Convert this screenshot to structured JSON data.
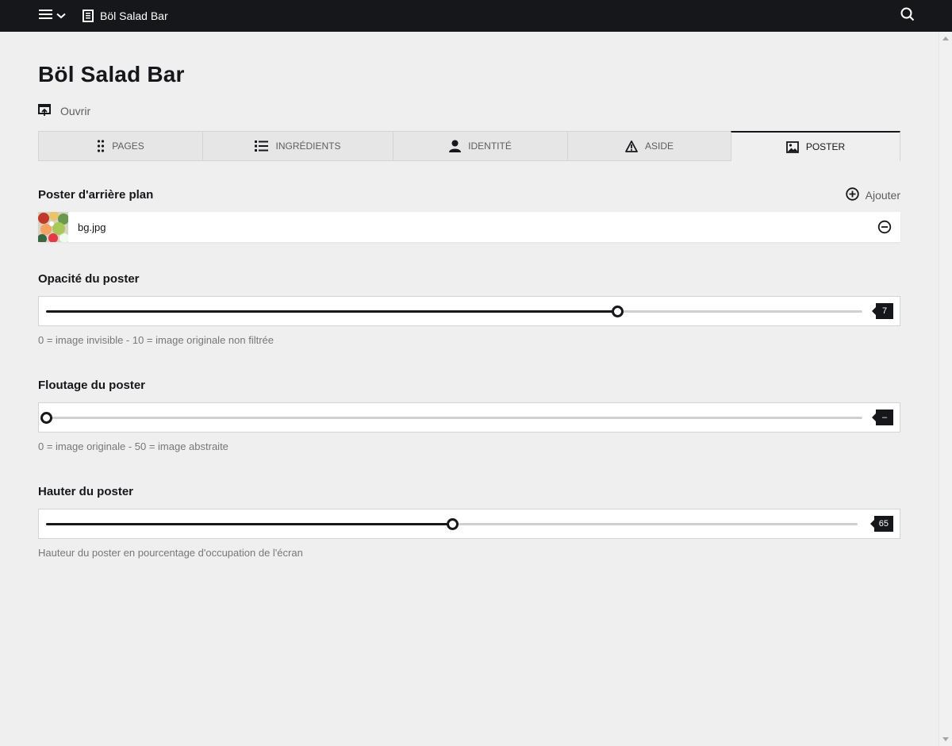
{
  "topbar": {
    "breadcrumb_label": "Böl Salad Bar"
  },
  "page": {
    "title": "Böl Salad Bar",
    "open_label": "Ouvrir"
  },
  "tabs": [
    {
      "label": "PAGES",
      "icon": "drag-dots-icon",
      "active": false
    },
    {
      "label": "INGRÉDIENTS",
      "icon": "list-icon",
      "active": false
    },
    {
      "label": "IDENTITÉ",
      "icon": "user-icon",
      "active": false
    },
    {
      "label": "ASIDE",
      "icon": "warning-icon",
      "active": false
    },
    {
      "label": "POSTER",
      "icon": "image-icon",
      "active": true
    }
  ],
  "poster_field": {
    "label": "Poster d'arrière plan",
    "add_label": "Ajouter",
    "file_name": "bg.jpg"
  },
  "opacity": {
    "label": "Opacité du poster",
    "value": "7",
    "fraction": 0.7,
    "help": "0 = image invisible - 10 = image originale non filtrée"
  },
  "blur": {
    "label": "Floutage du poster",
    "value": "–",
    "fraction": 0.0,
    "help": "0 = image originale - 50 = image abstraite"
  },
  "height": {
    "label": "Hauter du poster",
    "value": "65",
    "fraction": 0.5,
    "help": "Hauteur du poster en pourcentage d'occupation de l'écran"
  }
}
